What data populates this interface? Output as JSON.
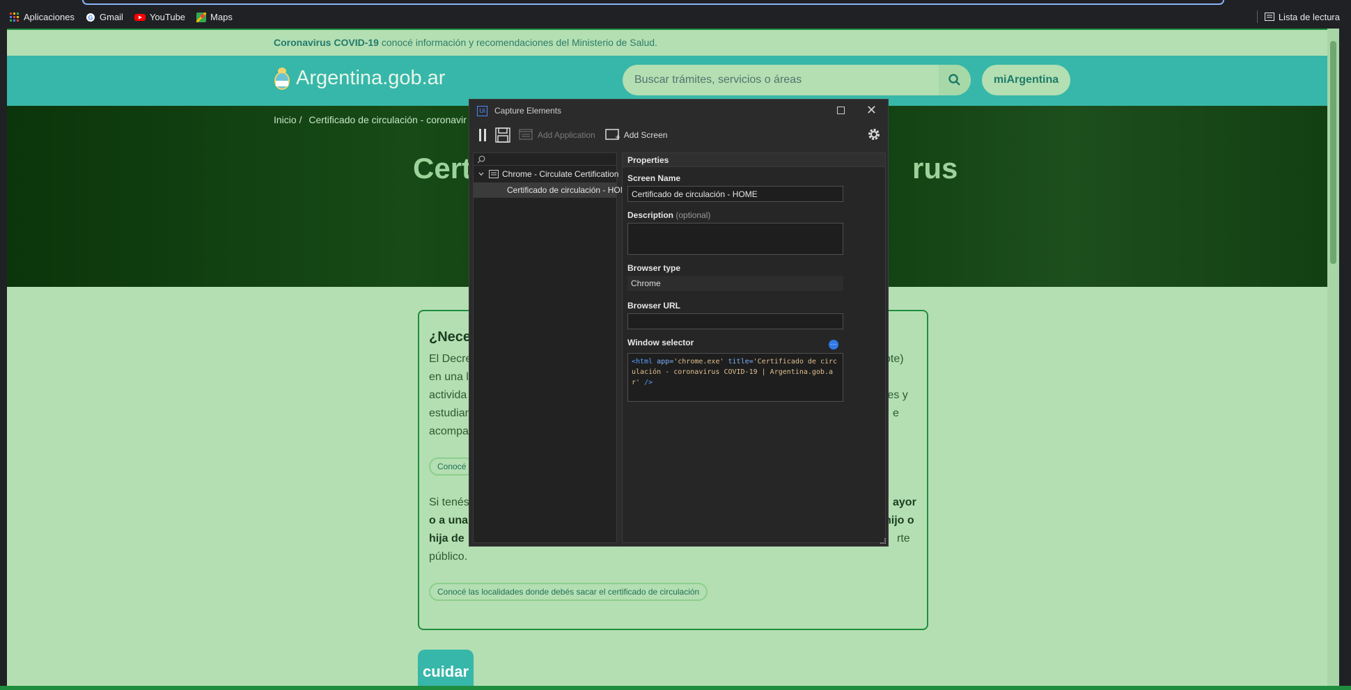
{
  "browser": {
    "bookmarks": [
      {
        "label": "Aplicaciones",
        "icon": "apps-grid-icon"
      },
      {
        "label": "Gmail",
        "icon": "google-icon"
      },
      {
        "label": "YouTube",
        "icon": "youtube-icon"
      },
      {
        "label": "Maps",
        "icon": "maps-icon"
      }
    ],
    "reading_list": "Lista de lectura"
  },
  "site": {
    "covid_strong": "Coronavirus COVID-19",
    "covid_text": " conocé información y recomendaciones del Ministerio de Salud.",
    "logo_text": "Argentina.gob.ar",
    "search_placeholder": "Buscar trámites, servicios o áreas",
    "mi_argentina": "miArgentina",
    "breadcrumb": [
      "Inicio /",
      "Certificado de circulación - coronavir"
    ],
    "hero_title_left": "Cert",
    "hero_title_right": "rus",
    "card": {
      "heading": "¿Nece",
      "lines": [
        "El Decre",
        "en una l",
        "activida",
        "estudian",
        "acompa"
      ],
      "right_lines": [
        "ote)",
        "",
        "tes y",
        "e"
      ],
      "pill1": "Conocé",
      "para2": [
        "Si tenés",
        "o a una",
        "hija de",
        "público."
      ],
      "para2_right": [
        "ayor",
        "hijo o",
        "rte"
      ],
      "pill2": "Conocé las localidades donde debés sacar el certificado de circulación"
    },
    "cuidar": "cuidar"
  },
  "dialog": {
    "title": "Capture Elements",
    "toolbar": {
      "add_application": "Add Application",
      "add_screen": "Add Screen"
    },
    "tree": {
      "app": "Chrome - Circulate Certification",
      "screen": "Certificado de circulación - HOME"
    },
    "properties": {
      "header": "Properties",
      "screen_name_label": "Screen Name",
      "screen_name_value": "Certificado de circulación - HOME",
      "description_label": "Description",
      "description_optional": "(optional)",
      "browser_type_label": "Browser type",
      "browser_type_value": "Chrome",
      "browser_url_label": "Browser URL",
      "window_selector_label": "Window selector",
      "selector_open": "<html",
      "selector_attr1": "app=",
      "selector_val1": "'chrome.exe'",
      "selector_attr2": "title=",
      "selector_val2": "'Certificado de circulación - coronavirus COVID-19 | Argentina.gob.ar'",
      "selector_close": "/>"
    }
  },
  "colors": {
    "accent": "#37b7a9",
    "page_bg": "#b4dfb2",
    "hero_bg": "#0d3e0d",
    "dialog_bg": "#2b2b2b"
  }
}
